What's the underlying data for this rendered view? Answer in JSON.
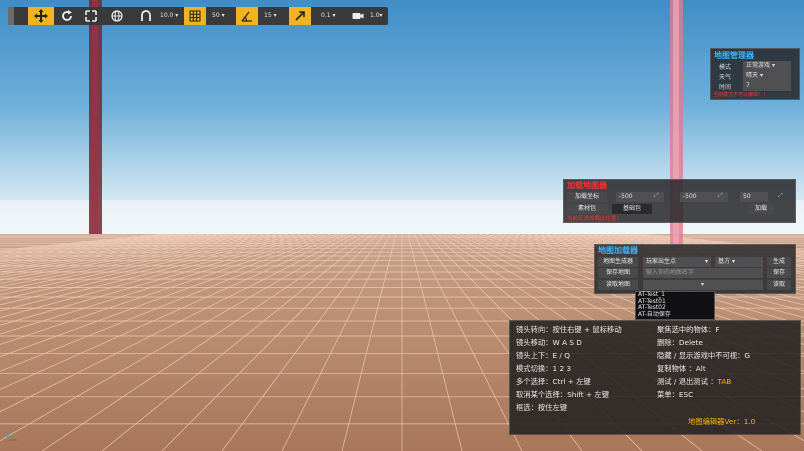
{
  "toolbar": {
    "snap_value_1": "10.0",
    "grid_size": "50",
    "angle_value": "15",
    "scale_value": "0.1",
    "camera_speed": "1.0"
  },
  "map_manager": {
    "title": "地图管理器",
    "mode_label": "模式",
    "mode_value": "正常游戏",
    "weather_label": "天气",
    "weather_value": "晴天",
    "time_label": "时间",
    "time_value": "7",
    "warning": "当前模式不可以编辑！！"
  },
  "load_panel": {
    "title": "加载地图器",
    "load_point_label": "加载坐标",
    "x_value": "-500",
    "y_value": "-500",
    "z_value": "50",
    "load_button": "加载",
    "material_pack": "素材包",
    "base_pack": "基础包",
    "warning": "当前无法加载此位置！"
  },
  "map_loader": {
    "title": "地图加载器",
    "generator_label": "地图生成器",
    "spawn_point": "玩家出生点",
    "tile_value": "基方",
    "generate_button": "生成",
    "save_map_button": "保存地图",
    "name_placeholder": "输入你的地图名字",
    "save_button": "保存",
    "read_map_button": "读取地图",
    "read_button": "读取",
    "saved_maps": [
      "AT-Test_1",
      "AT-Test01",
      "AT-Test02",
      "AT-自动保存"
    ]
  },
  "help": {
    "rows": [
      {
        "left": "镜头转向：按住右键 + 鼠标移动",
        "right": "聚焦选中的物体：F"
      },
      {
        "left": "镜头移动：W A S D",
        "right": "删除：Delete"
      },
      {
        "left": "镜头上下：E / Q",
        "right": "隐藏 / 显示游戏中不可视：G"
      },
      {
        "left": "模式切换：1 2 3",
        "right": "复制物体 ：Alt"
      },
      {
        "left": "多个选择：Ctrl + 左键",
        "right_prefix": "测试 / 退出测试 ：",
        "right_key": "TAB"
      },
      {
        "left": "取消某个选择：Shift + 左键",
        "right": "菜单：ESC"
      },
      {
        "left": "框选：按住左键"
      }
    ],
    "version": "地图编辑器Ver：1.0"
  },
  "colors": {
    "accent": "#f0b41e",
    "panel_title_blue": "#3ab4ff",
    "panel_title_red": "#ff3030",
    "warning_red": "#ff3030",
    "key_orange": "#ffb400"
  }
}
